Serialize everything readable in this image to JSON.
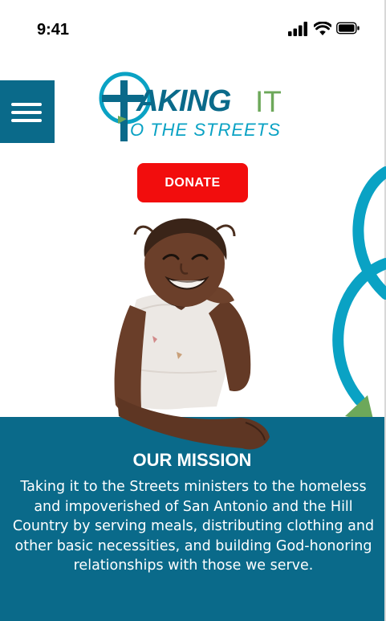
{
  "status_bar": {
    "time": "9:41",
    "icons": [
      "cellular-signal-icon",
      "wifi-icon",
      "battery-icon"
    ]
  },
  "header": {
    "menu_icon": "hamburger-menu-icon",
    "logo": {
      "word_taking": "AKING",
      "word_it": "IT",
      "tagline": "O THE STREETS",
      "icon": "cross-circle-icon"
    }
  },
  "donate": {
    "label": "DONATE"
  },
  "hero": {
    "image": "smiling-child-photo"
  },
  "mission": {
    "title": "OUR MISSION",
    "body": "Taking it to the Streets ministers to the homeless and impoverished of San Antonio and the Hill Country by serving meals, distributing clothing and other basic necessities, and building God-honoring relationships with those we serve."
  },
  "colors": {
    "brand_teal": "#0a6a8a",
    "accent_cyan": "#0aa2c4",
    "accent_green": "#6da85a",
    "donate_red": "#f20d0d",
    "background": "#ffffff"
  }
}
